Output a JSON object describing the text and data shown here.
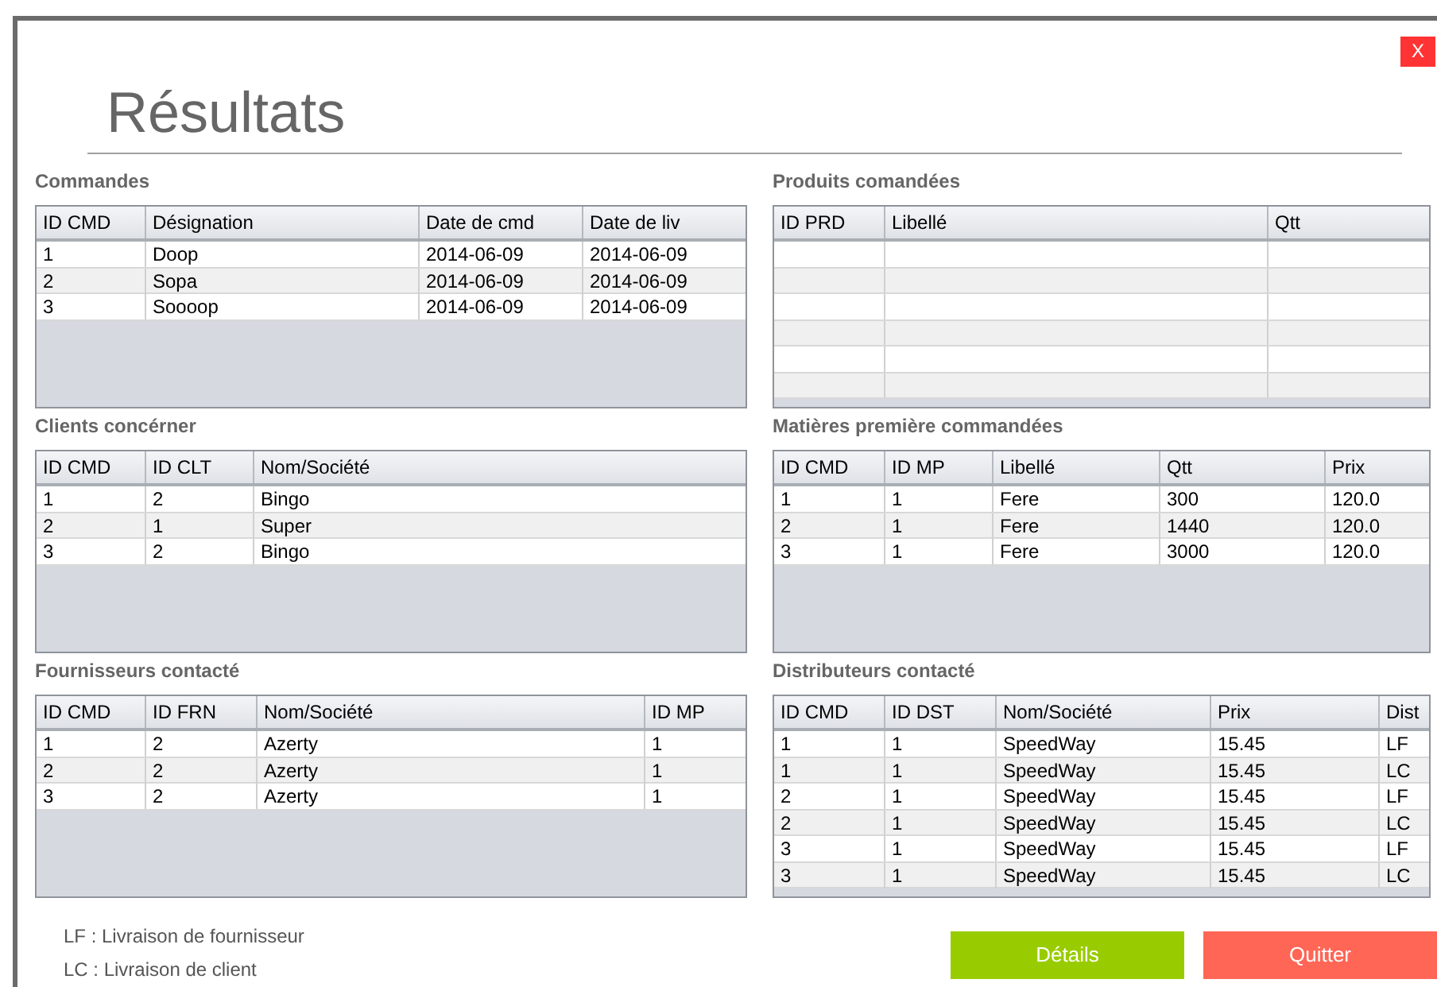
{
  "window": {
    "title": "Résultats",
    "close": "X"
  },
  "panels": [
    {
      "title": "Commandes",
      "columns": [
        "ID CMD",
        "Désignation",
        "Date de cmd",
        "Date de liv"
      ],
      "rows": [
        [
          "1",
          "Doop",
          "2014-06-09",
          "2014-06-09"
        ],
        [
          "2",
          "Sopa",
          "2014-06-09",
          "2014-06-09"
        ],
        [
          "3",
          "Soooop",
          "2014-06-09",
          "2014-06-09"
        ]
      ]
    },
    {
      "title": "Produits comandées",
      "columns": [
        "ID PRD",
        "Libellé",
        "Qtt"
      ],
      "blank_rows": true
    },
    {
      "title": "Clients concérner",
      "columns": [
        "ID CMD",
        "ID CLT",
        "Nom/Société"
      ],
      "rows": [
        [
          "1",
          "2",
          "Bingo"
        ],
        [
          "2",
          "1",
          "Super"
        ],
        [
          "3",
          "2",
          "Bingo"
        ]
      ]
    },
    {
      "title": "Matières première commandées",
      "columns": [
        "ID CMD",
        "ID MP",
        "Libellé",
        "Qtt",
        "Prix"
      ],
      "rows": [
        [
          "1",
          "1",
          "Fere",
          "300",
          "120.0"
        ],
        [
          "2",
          "1",
          "Fere",
          "1440",
          "120.0"
        ],
        [
          "3",
          "1",
          "Fere",
          "3000",
          "120.0"
        ]
      ]
    },
    {
      "title": "Fournisseurs contacté",
      "columns": [
        "ID CMD",
        "ID FRN",
        "Nom/Société",
        "ID MP"
      ],
      "rows": [
        [
          "1",
          "2",
          "Azerty",
          "1"
        ],
        [
          "2",
          "2",
          "Azerty",
          "1"
        ],
        [
          "3",
          "2",
          "Azerty",
          "1"
        ]
      ]
    },
    {
      "title": "Distributeurs contacté",
      "columns": [
        "ID CMD",
        "ID DST",
        "Nom/Société",
        "Prix",
        "Dist"
      ],
      "rows": [
        [
          "1",
          "1",
          "SpeedWay",
          "15.45",
          "LF"
        ],
        [
          "1",
          "1",
          "SpeedWay",
          "15.45",
          "LC"
        ],
        [
          "2",
          "1",
          "SpeedWay",
          "15.45",
          "LF"
        ],
        [
          "2",
          "1",
          "SpeedWay",
          "15.45",
          "LC"
        ],
        [
          "3",
          "1",
          "SpeedWay",
          "15.45",
          "LF"
        ],
        [
          "3",
          "1",
          "SpeedWay",
          "15.45",
          "LC"
        ]
      ]
    }
  ],
  "legend": [
    "LF : Livraison de fournisseur",
    "LC : Livraison de client"
  ],
  "buttons": [
    {
      "label": "Détails",
      "kind": "primary"
    },
    {
      "label": "Quitter",
      "kind": "danger"
    }
  ]
}
